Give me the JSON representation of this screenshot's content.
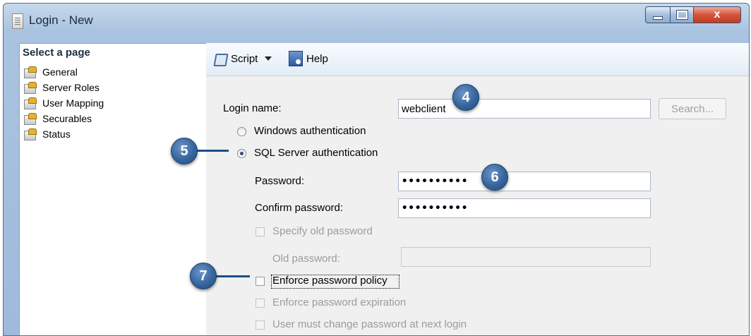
{
  "window": {
    "title": "Login - New",
    "close_glyph": "x"
  },
  "left_pane": {
    "header": "Select a page",
    "items": [
      {
        "label": "General",
        "icon": "page-icon"
      },
      {
        "label": "Server Roles",
        "icon": "page-icon"
      },
      {
        "label": "User Mapping",
        "icon": "page-icon"
      },
      {
        "label": "Securables",
        "icon": "page-icon"
      },
      {
        "label": "Status",
        "icon": "page-icon"
      }
    ]
  },
  "toolbar": {
    "script_label": "Script",
    "help_label": "Help"
  },
  "form": {
    "login_name_label": "Login name:",
    "login_name_value": "webclient",
    "search_label": "Search...",
    "windows_auth_label": "Windows authentication",
    "sql_auth_label": "SQL Server authentication",
    "selected_auth": "SQL Server authentication",
    "password_label": "Password:",
    "password_value": "••••••••••",
    "confirm_password_label": "Confirm password:",
    "confirm_password_value": "••••••••••",
    "specify_old_password_label": "Specify old password",
    "old_password_label": "Old password:",
    "old_password_value": "",
    "enforce_policy_label": "Enforce password policy",
    "enforce_policy_checked": false,
    "enforce_expiration_label": "Enforce password expiration",
    "must_change_label": "User must change password at next login"
  },
  "callouts": [
    "4",
    "5",
    "6",
    "7"
  ],
  "colors": {
    "callout": "#2f5d95",
    "close_button": "#c94a30",
    "title_bar": "#a9c3e0"
  }
}
